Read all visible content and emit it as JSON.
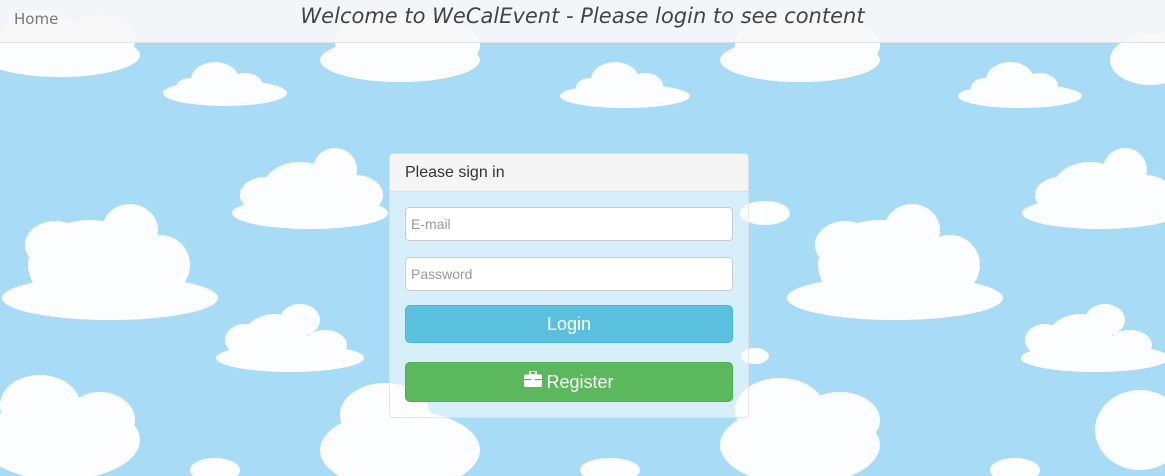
{
  "navbar": {
    "home_label": "Home",
    "title": "Welcome to WeCalEvent - Please login to see content"
  },
  "login_panel": {
    "heading": "Please sign in",
    "email_placeholder": "E-mail",
    "password_placeholder": "Password",
    "login_label": "Login",
    "register_label": "Register",
    "register_icon": "briefcase-icon"
  },
  "colors": {
    "sky": "#a7dbf6",
    "cloud": "#ffffff",
    "login_button": "#5bc0de",
    "register_button": "#5cb85c"
  }
}
